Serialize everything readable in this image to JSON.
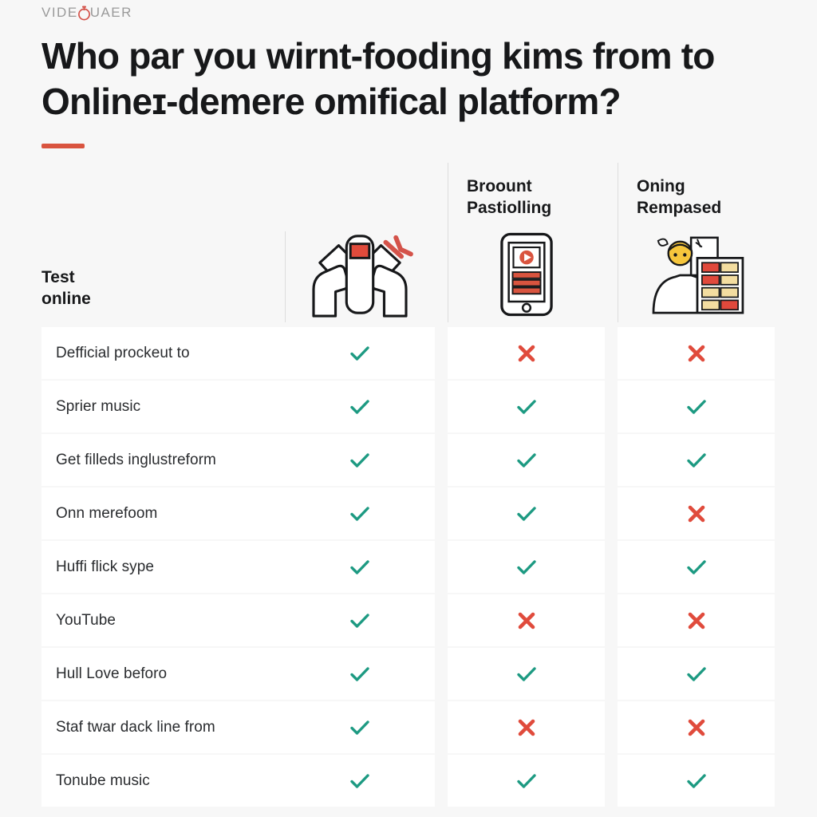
{
  "brand": {
    "text_before": "VIDE",
    "mark_icon": "video-stopwatch-logo-icon",
    "text_after": "UAER",
    "full": "VIDEUQUAER"
  },
  "headline": {
    "text": "Who par you wirnt-fooding kims from to Onlineɪ-demere omifical platform?"
  },
  "accent": {
    "color": "#d9543f"
  },
  "colors": {
    "check": "#1d9a82",
    "cross": "#e04b3c",
    "page_background": "#f7f7f7",
    "cell_background": "#ffffff",
    "divider": "#dddddd",
    "heading_text": "#17181a",
    "row_text": "#2a2c2f"
  },
  "table": {
    "columns": [
      {
        "id": "label",
        "title": "Test\nonline",
        "icon": null
      },
      {
        "id": "brand",
        "title": "",
        "icon": "backpack-hands-illustration-icon"
      },
      {
        "id": "mobile",
        "title": "Broount\nPastiolling",
        "icon": "smartphone-video-playlist-icon"
      },
      {
        "id": "desktop",
        "title": "Oning\nRempased",
        "icon": "person-comparison-chart-icon"
      }
    ],
    "rows": [
      {
        "label": "Defficial prockeut to",
        "marks": [
          "check",
          "cross",
          "cross"
        ]
      },
      {
        "label": "Sprier music",
        "marks": [
          "check",
          "check",
          "check"
        ]
      },
      {
        "label": "Get filleds inglustreform",
        "marks": [
          "check",
          "check",
          "check"
        ]
      },
      {
        "label": "Onn merefoom",
        "marks": [
          "check",
          "check",
          "cross"
        ]
      },
      {
        "label": "Huffi flick sype",
        "marks": [
          "check",
          "check",
          "check"
        ]
      },
      {
        "label": "YouTube",
        "marks": [
          "check",
          "cross",
          "cross"
        ]
      },
      {
        "label": "Hull Love beforo",
        "marks": [
          "check",
          "check",
          "check"
        ]
      },
      {
        "label": "Staf twar dack line from",
        "marks": [
          "check",
          "cross",
          "cross"
        ]
      },
      {
        "label": "Tonube music",
        "marks": [
          "check",
          "check",
          "check"
        ]
      }
    ]
  }
}
